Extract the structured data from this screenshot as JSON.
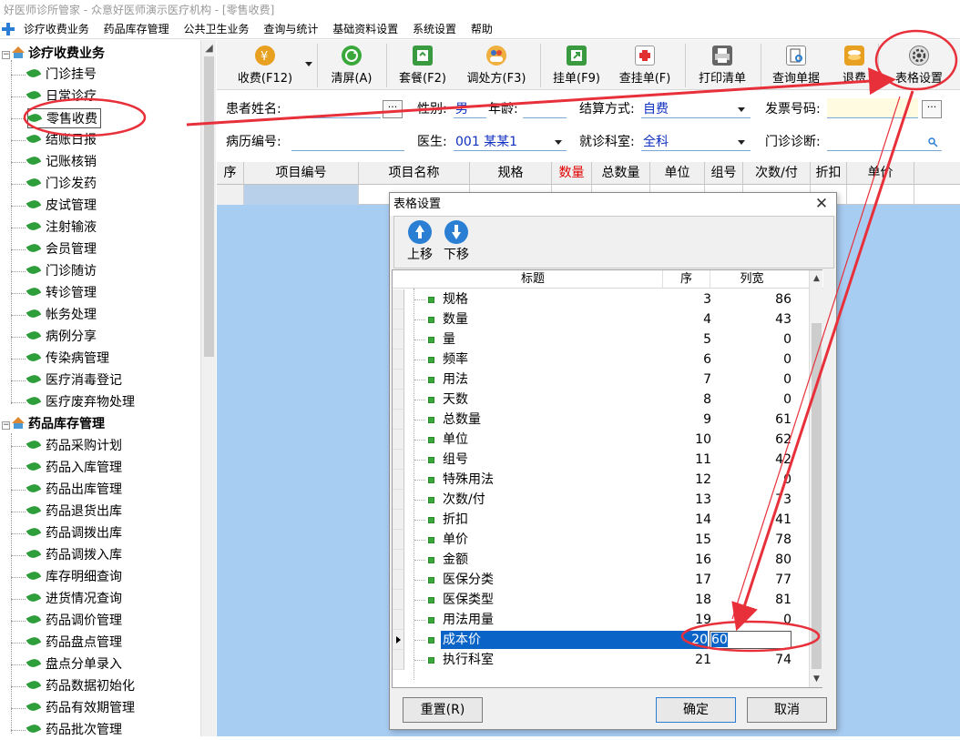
{
  "window": {
    "title": "好医师诊所管家 - 众意好医师演示医疗机构 - [零售收费]"
  },
  "menu": [
    "诊疗收费业务",
    "药品库存管理",
    "公共卫生业务",
    "查询与统计",
    "基础资料设置",
    "系统设置",
    "帮助"
  ],
  "sidebar": {
    "group1": "诊疗收费业务",
    "items1": [
      "门诊挂号",
      "日常诊疗",
      "零售收费",
      "结账日报",
      "记账核销",
      "门诊发药",
      "皮试管理",
      "注射输液",
      "会员管理",
      "门诊随访",
      "转诊管理",
      "帐务处理",
      "病例分享",
      "传染病管理",
      "医疗消毒登记",
      "医疗废弃物处理"
    ],
    "group2": "药品库存管理",
    "items2": [
      "药品采购计划",
      "药品入库管理",
      "药品出库管理",
      "药品退货出库",
      "药品调拨出库",
      "药品调拨入库",
      "库存明细查询",
      "进货情况查询",
      "药品调价管理",
      "药品盘点管理",
      "盘点分单录入",
      "药品数据初始化",
      "药品有效期管理",
      "药品批次管理"
    ]
  },
  "toolbar": {
    "charge": "收费(F12)",
    "clear": "清屏(A)",
    "package": "套餐(F2)",
    "prescription": "调处方(F3)",
    "hang": "挂单(F9)",
    "find_hang": "查挂单(F)",
    "print": "打印清单",
    "query": "查询单据",
    "refund": "退费",
    "table_settings": "表格设置"
  },
  "form": {
    "patient_name_label": "患者姓名:",
    "gender_label": "性别:",
    "gender_value": "男",
    "age_label": "年龄:",
    "settlement_label": "结算方式:",
    "settlement_value": "自费",
    "invoice_label": "发票号码:",
    "record_label": "病历编号:",
    "doctor_label": "医生:",
    "doctor_value": "001 某某1",
    "dept_label": "就诊科室:",
    "dept_value": "全科",
    "diagnosis_label": "门诊诊断:"
  },
  "grid": {
    "headers": [
      "序",
      "项目编号",
      "项目名称",
      "规格",
      "数量",
      "总数量",
      "单位",
      "组号",
      "次数/付",
      "折扣",
      "单价"
    ],
    "highlight_color": "#e00000"
  },
  "dialog": {
    "title": "表格设置",
    "up": "上移",
    "down": "下移",
    "col_title": "标题",
    "col_seq": "序",
    "col_width": "列宽",
    "rows": [
      {
        "title": "规格",
        "seq": "3",
        "width": "86"
      },
      {
        "title": "数量",
        "seq": "4",
        "width": "43"
      },
      {
        "title": "量",
        "seq": "5",
        "width": "0"
      },
      {
        "title": "频率",
        "seq": "6",
        "width": "0"
      },
      {
        "title": "用法",
        "seq": "7",
        "width": "0"
      },
      {
        "title": "天数",
        "seq": "8",
        "width": "0"
      },
      {
        "title": "总数量",
        "seq": "9",
        "width": "61"
      },
      {
        "title": "单位",
        "seq": "10",
        "width": "62"
      },
      {
        "title": "组号",
        "seq": "11",
        "width": "42"
      },
      {
        "title": "特殊用法",
        "seq": "12",
        "width": "0"
      },
      {
        "title": "次数/付",
        "seq": "13",
        "width": "73"
      },
      {
        "title": "折扣",
        "seq": "14",
        "width": "41"
      },
      {
        "title": "单价",
        "seq": "15",
        "width": "78"
      },
      {
        "title": "金额",
        "seq": "16",
        "width": "80"
      },
      {
        "title": "医保分类",
        "seq": "17",
        "width": "77"
      },
      {
        "title": "医保类型",
        "seq": "18",
        "width": "81"
      },
      {
        "title": "用法用量",
        "seq": "19",
        "width": "0"
      },
      {
        "title": "成本价",
        "seq": "20",
        "width": "60"
      },
      {
        "title": "执行科室",
        "seq": "21",
        "width": "74"
      }
    ],
    "reset": "重置(R)",
    "ok": "确定",
    "cancel": "取消"
  },
  "annotation_color": "#e8303a"
}
